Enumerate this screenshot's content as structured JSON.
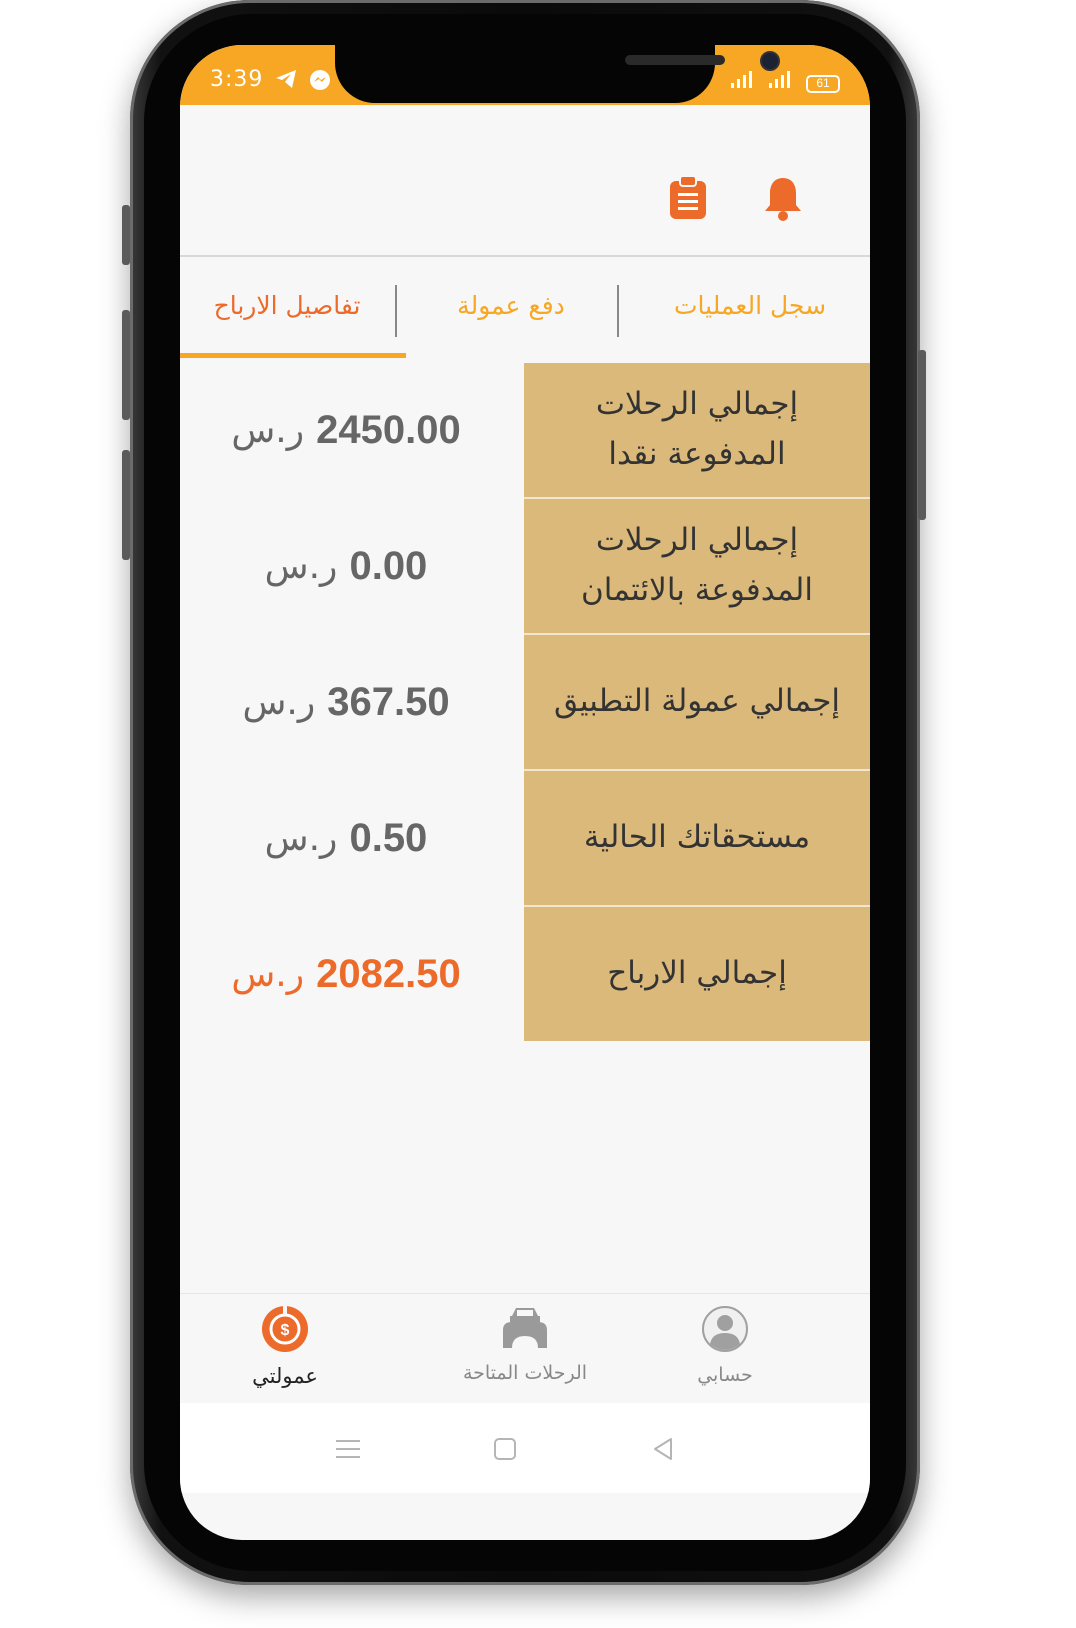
{
  "status_bar": {
    "time": "3:39",
    "battery": "61",
    "icons_left": [
      "telegram-icon",
      "messenger-icon"
    ],
    "icons_right": [
      "signal-icon",
      "signal-icon",
      "battery-icon"
    ]
  },
  "header": {
    "icons": [
      "notification-bell-icon",
      "clipboard-icon"
    ]
  },
  "tabs": [
    {
      "label": "سجل العمليات",
      "active": false
    },
    {
      "label": "دفع عمولة",
      "active": false
    },
    {
      "label": "تفاصيل الارباح",
      "active": true
    }
  ],
  "earnings": {
    "rows": [
      {
        "label": "إجمالي الرحلات المدفوعة نقدا",
        "value": "2450.00",
        "currency": "ر.س"
      },
      {
        "label": "إجمالي الرحلات المدفوعة بالائتمان",
        "value": "0.00",
        "currency": "ر.س"
      },
      {
        "label": "إجمالي عمولة التطبيق",
        "value": "367.50",
        "currency": "ر.س"
      },
      {
        "label": "مستحقاتك الحالية",
        "value": "0.50",
        "currency": "ر.س"
      },
      {
        "label": "إجمالي الارباح",
        "value": "2082.50",
        "currency": "ر.س"
      }
    ]
  },
  "bottom_nav": [
    {
      "label": "عمولتي",
      "icon": "commission-icon",
      "active": true
    },
    {
      "label": "الرحلات المتاحة",
      "icon": "car-icon",
      "active": false
    },
    {
      "label": "حسابي",
      "icon": "profile-icon",
      "active": false
    }
  ],
  "colors": {
    "accent": "#f7a723",
    "accent_dark": "#ec6a2a",
    "label_bg": "#dbb97a"
  }
}
